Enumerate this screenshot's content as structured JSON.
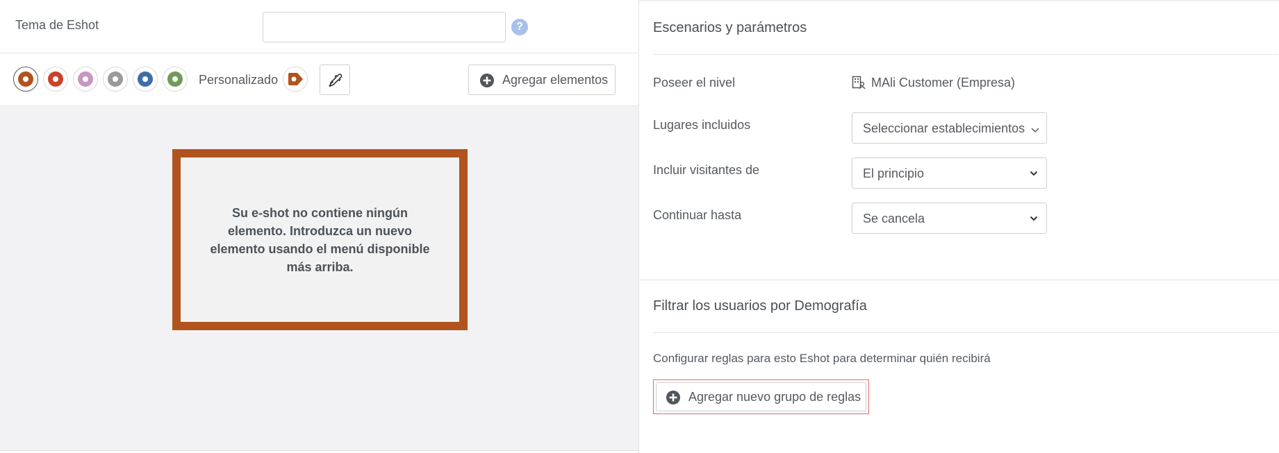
{
  "left": {
    "topic": {
      "label": "Tema de Eshot",
      "value": "",
      "placeholder": "",
      "help_glyph": "?"
    },
    "toolbar": {
      "swatches": [
        {
          "color": "#b0531e",
          "selected": true
        },
        {
          "color": "#c9422a",
          "selected": false
        },
        {
          "color": "#c996c4",
          "selected": false
        },
        {
          "color": "#9a9a9a",
          "selected": false
        },
        {
          "color": "#3e6fa8",
          "selected": false
        },
        {
          "color": "#6f9a5a",
          "selected": false
        }
      ],
      "custom_label": "Personalizado",
      "custom_color": "#b0531e",
      "eyedropper_icon": "eyedropper-icon",
      "add_elements_label": "Agregar elementos"
    },
    "canvas": {
      "frame_color": "#b0531e",
      "empty_message": "Su e-shot no contiene ningún elemento. Introduzca un nuevo elemento usando el menú disponible más arriba."
    }
  },
  "right": {
    "scenarios": {
      "title": "Escenarios y parámetros",
      "level_label": "Poseer el nivel",
      "level_value": "MAli Customer (Empresa)",
      "places_label": "Lugares incluidos",
      "places_value": "Seleccionar establecimientos",
      "visitors_label": "Incluir visitantes de",
      "visitors_value": "El principio",
      "continue_label": "Continuar hasta",
      "continue_value": "Se cancela"
    },
    "demography": {
      "title": "Filtrar los usuarios por Demografía",
      "description": "Configurar reglas para esto Eshot para determinar quién recibirá",
      "add_group_label": "Agregar nuevo grupo de reglas"
    }
  }
}
